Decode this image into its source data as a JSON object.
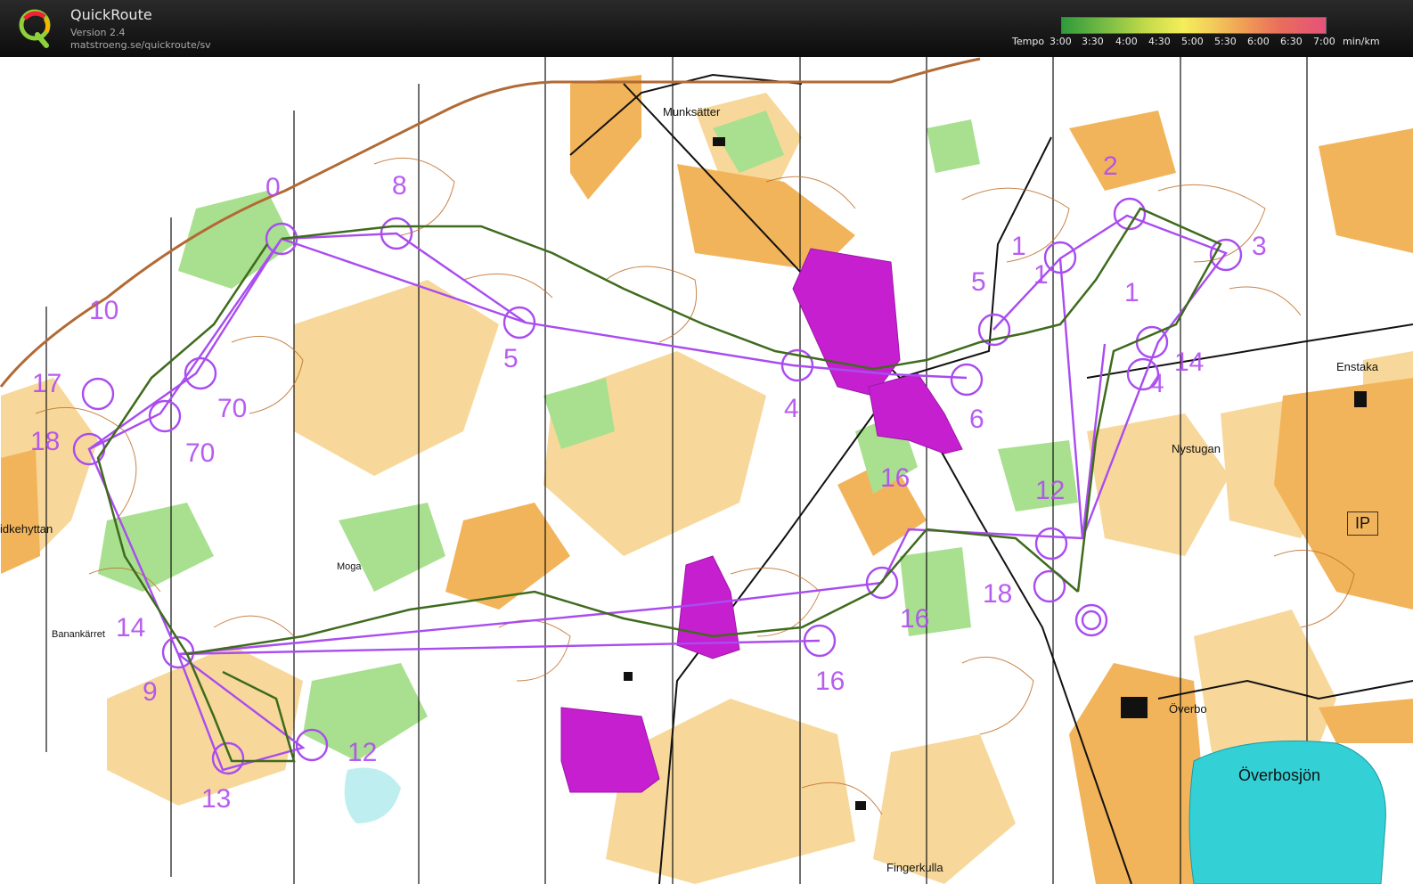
{
  "app": {
    "name": "QuickRoute",
    "version": "Version 2.4",
    "url": "matstroeng.se/quickroute/sv"
  },
  "pace_scale": {
    "label": "Tempo",
    "ticks": [
      "3:00",
      "3:30",
      "4:00",
      "4:30",
      "5:00",
      "5:30",
      "6:00",
      "6:30",
      "7:00"
    ],
    "unit": "min/km",
    "colors": [
      "#2f9a3b",
      "#7fbf45",
      "#c8dc4a",
      "#f4ee5a",
      "#f3c85a",
      "#f09a55",
      "#e86d5c",
      "#e6517a"
    ]
  },
  "map": {
    "place_names": {
      "munksatter": "Munksätter",
      "enstaka": "Enstaka",
      "nystugan": "Nystugan",
      "ip": "IP",
      "lidkehyttan": "idkehyttan",
      "moga": "Moga",
      "banankarret": "Banankärret",
      "overbo": "Överbo",
      "overbosjon": "Överbosjön",
      "fingerkulla": "Fingerkulla"
    },
    "control_numbers": {
      "c_0": "0",
      "c_8": "8",
      "c_2": "2",
      "c_3": "3",
      "c_1a": "1",
      "c_1b": "1",
      "c_1c": "1",
      "c_5a": "5",
      "c_5b": "5",
      "c_10a": "10",
      "c_17": "17",
      "c_18a": "18",
      "c_70a": "70",
      "c_70b": "70",
      "c_4a": "4",
      "c_4b": "4",
      "c_6": "6",
      "c_14a": "14",
      "c_16a": "16",
      "c_12a": "12",
      "c_18b": "18",
      "c_16b": "16",
      "c_16c": "16",
      "c_14b": "14",
      "c_9": "9",
      "c_12b": "12",
      "c_13": "13"
    },
    "colors": {
      "open_land": "#f7d89a",
      "rough_open": "#f3b95a",
      "vegetation_green": "#9fdc8a",
      "water": "#33d0d6",
      "contours": "#c0702a",
      "forbidden": "#c51fd0",
      "course": "#a94cf0"
    }
  }
}
